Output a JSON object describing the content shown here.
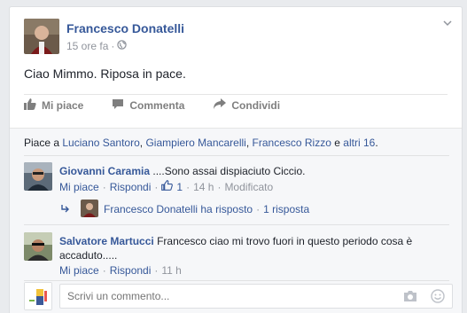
{
  "post": {
    "author": "Francesco Donatelli",
    "time": "15 ore fa",
    "separator": "·",
    "text": "Ciao Mimmo. Riposa in pace."
  },
  "actions": {
    "like": "Mi piace",
    "comment": "Commenta",
    "share": "Condividi"
  },
  "likes_summary": {
    "prefix": "Piace a",
    "names": [
      "Luciano Santoro",
      "Giampiero Mancarelli",
      "Francesco Rizzo"
    ],
    "sep1": ",",
    "sep2": ",",
    "and": "e",
    "others": "altri 16",
    "period": "."
  },
  "comments": [
    {
      "author": "Giovanni Caramia",
      "text": "....Sono assai dispiaciuto Ciccio.",
      "like": "Mi piace",
      "reply": "Rispondi",
      "like_count": "1",
      "time": "14 h",
      "edited": "Modificato",
      "reply_preview": {
        "text": "Francesco Donatelli ha risposto",
        "sep": "·",
        "count": "1 risposta"
      }
    },
    {
      "author": "Salvatore Martucci",
      "text_line1": "Francesco ciao mi trovo fuori in questo periodo cosa è",
      "text_line2": "accaduto.....",
      "like": "Mi piace",
      "reply": "Rispondi",
      "time": "11 h"
    }
  ],
  "composer": {
    "placeholder": "Scrivi un commento..."
  },
  "dot": "·",
  "colors": {
    "link": "#365899",
    "muted": "#90949c",
    "bg": "#f6f7f9"
  }
}
